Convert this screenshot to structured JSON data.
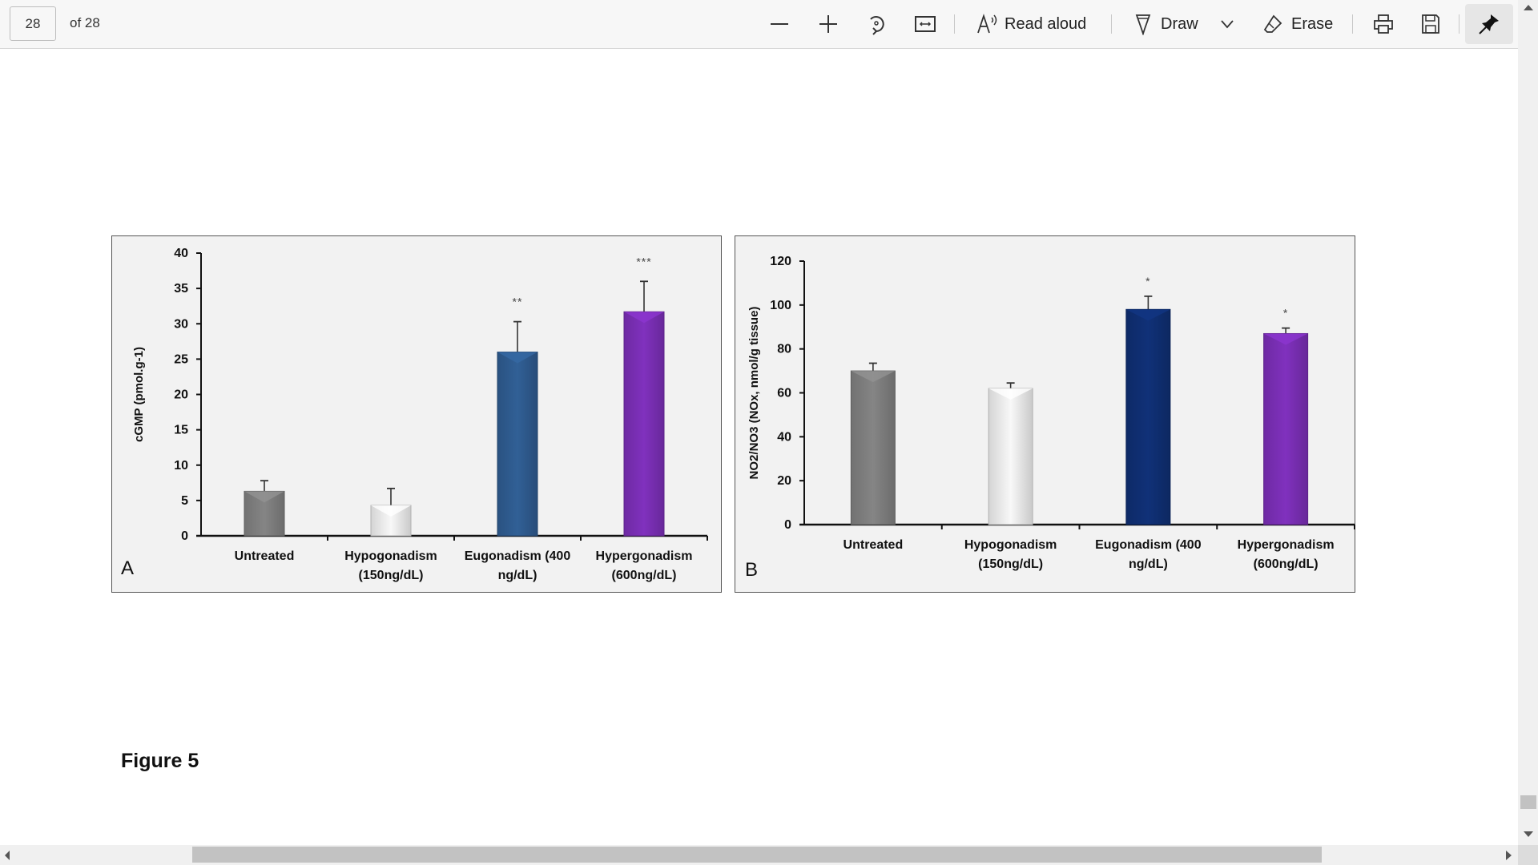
{
  "toolbar": {
    "page_current": "28",
    "page_total_label": "of 28",
    "zoom_out_icon": "minus-icon",
    "zoom_in_icon": "plus-icon",
    "rotate_icon": "rotate-icon",
    "fit_icon": "fit-width-icon",
    "read_aloud_label": "Read aloud",
    "draw_label": "Draw",
    "erase_label": "Erase",
    "print_icon": "print-icon",
    "save_icon": "save-icon",
    "pin_icon": "pin-icon"
  },
  "document": {
    "caption": "Figure 5"
  },
  "chart_data": [
    {
      "type": "bar",
      "panel_label": "A",
      "title": "",
      "xlabel": "",
      "ylabel": "cGMP (pmol.g-1)",
      "ylim": [
        0,
        40
      ],
      "yticks": [
        0,
        5,
        10,
        15,
        20,
        25,
        30,
        35,
        40
      ],
      "grid": false,
      "categories": [
        "Untreated",
        "Hypogonadism (150ng/dL)",
        "Eugonadism (400 ng/dL)",
        "Hypergonadism (600ng/dL)"
      ],
      "category_lines": [
        [
          "Untreated"
        ],
        [
          "Hypogonadism",
          "(150ng/dL)"
        ],
        [
          "Eugonadism (400",
          "ng/dL)"
        ],
        [
          "Hypergonadism",
          "(600ng/dL)"
        ]
      ],
      "values": [
        6.3,
        4.3,
        26.0,
        31.7
      ],
      "errors": [
        1.5,
        2.4,
        4.3,
        4.3
      ],
      "significance": [
        "",
        "",
        "**",
        "***"
      ],
      "colors": [
        "#7f7f7f",
        "#ececec",
        "#2f5b8f",
        "#7a2fb5"
      ]
    },
    {
      "type": "bar",
      "panel_label": "B",
      "title": "",
      "xlabel": "",
      "ylabel": "NO2/NO3 (NOx, nmol/g tissue)",
      "ylim": [
        0,
        120
      ],
      "yticks": [
        0,
        20,
        40,
        60,
        80,
        100,
        120
      ],
      "grid": false,
      "categories": [
        "Untreated",
        "Hypogonadism (150ng/dL)",
        "Eugonadism (400 ng/dL)",
        "Hypergonadism (600ng/dL)"
      ],
      "category_lines": [
        [
          "Untreated"
        ],
        [
          "Hypogonadism",
          "(150ng/dL)"
        ],
        [
          "Eugonadism (400",
          "ng/dL)"
        ],
        [
          "Hypergonadism",
          "(600ng/dL)"
        ]
      ],
      "values": [
        70,
        62,
        98,
        87
      ],
      "errors": [
        3.5,
        2.5,
        6,
        2.5
      ],
      "significance": [
        "",
        "",
        "*",
        "*"
      ],
      "colors": [
        "#7f7f7f",
        "#ececec",
        "#0f2f72",
        "#7a2fb5"
      ]
    }
  ]
}
